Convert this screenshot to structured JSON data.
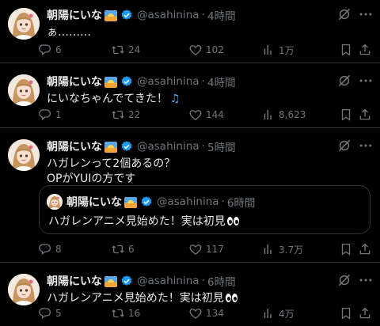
{
  "colors": {
    "background": "#000000",
    "text": "#e7e9ea",
    "muted": "#71767b",
    "divider": "#2f3336",
    "verified": "#1d9bf0"
  },
  "icons": [
    "reply-icon",
    "retweet-icon",
    "like-icon",
    "views-icon",
    "bookmark-icon",
    "share-icon",
    "grok-icon",
    "more-icon",
    "verified-badge-icon",
    "sunrise-emoji-icon",
    "eyes-emoji-icon",
    "music-notes-emoji-icon"
  ],
  "tweets": [
    {
      "name": "朝陽にいな",
      "handle": "@asahinina",
      "sep": "·",
      "time": "4時間",
      "text": "ぁ………",
      "replies": "6",
      "retweets": "24",
      "likes": "102",
      "views": "1万"
    },
    {
      "name": "朝陽にいな",
      "handle": "@asahinina",
      "sep": "·",
      "time": "4時間",
      "text": "にいなちゃんでてきた！",
      "replies": "1",
      "retweets": "22",
      "likes": "144",
      "views": "8,623"
    },
    {
      "name": "朝陽にいな",
      "handle": "@asahinina",
      "sep": "·",
      "time": "5時間",
      "text_line1": "ハガレンって2個あるの？",
      "text_line2": "OPがYUIの方です",
      "quote": {
        "name": "朝陽にいな",
        "handle": "@asahinina",
        "sep": "·",
        "time": "6時間",
        "text": "ハガレンアニメ見始めた！実は初見"
      },
      "replies": "8",
      "retweets": "6",
      "likes": "117",
      "views": "3.7万"
    },
    {
      "name": "朝陽にいな",
      "handle": "@asahinina",
      "sep": "·",
      "time": "6時間",
      "text": "ハガレンアニメ見始めた！実は初見",
      "replies": "5",
      "retweets": "16",
      "likes": "134",
      "views": "4万"
    }
  ]
}
